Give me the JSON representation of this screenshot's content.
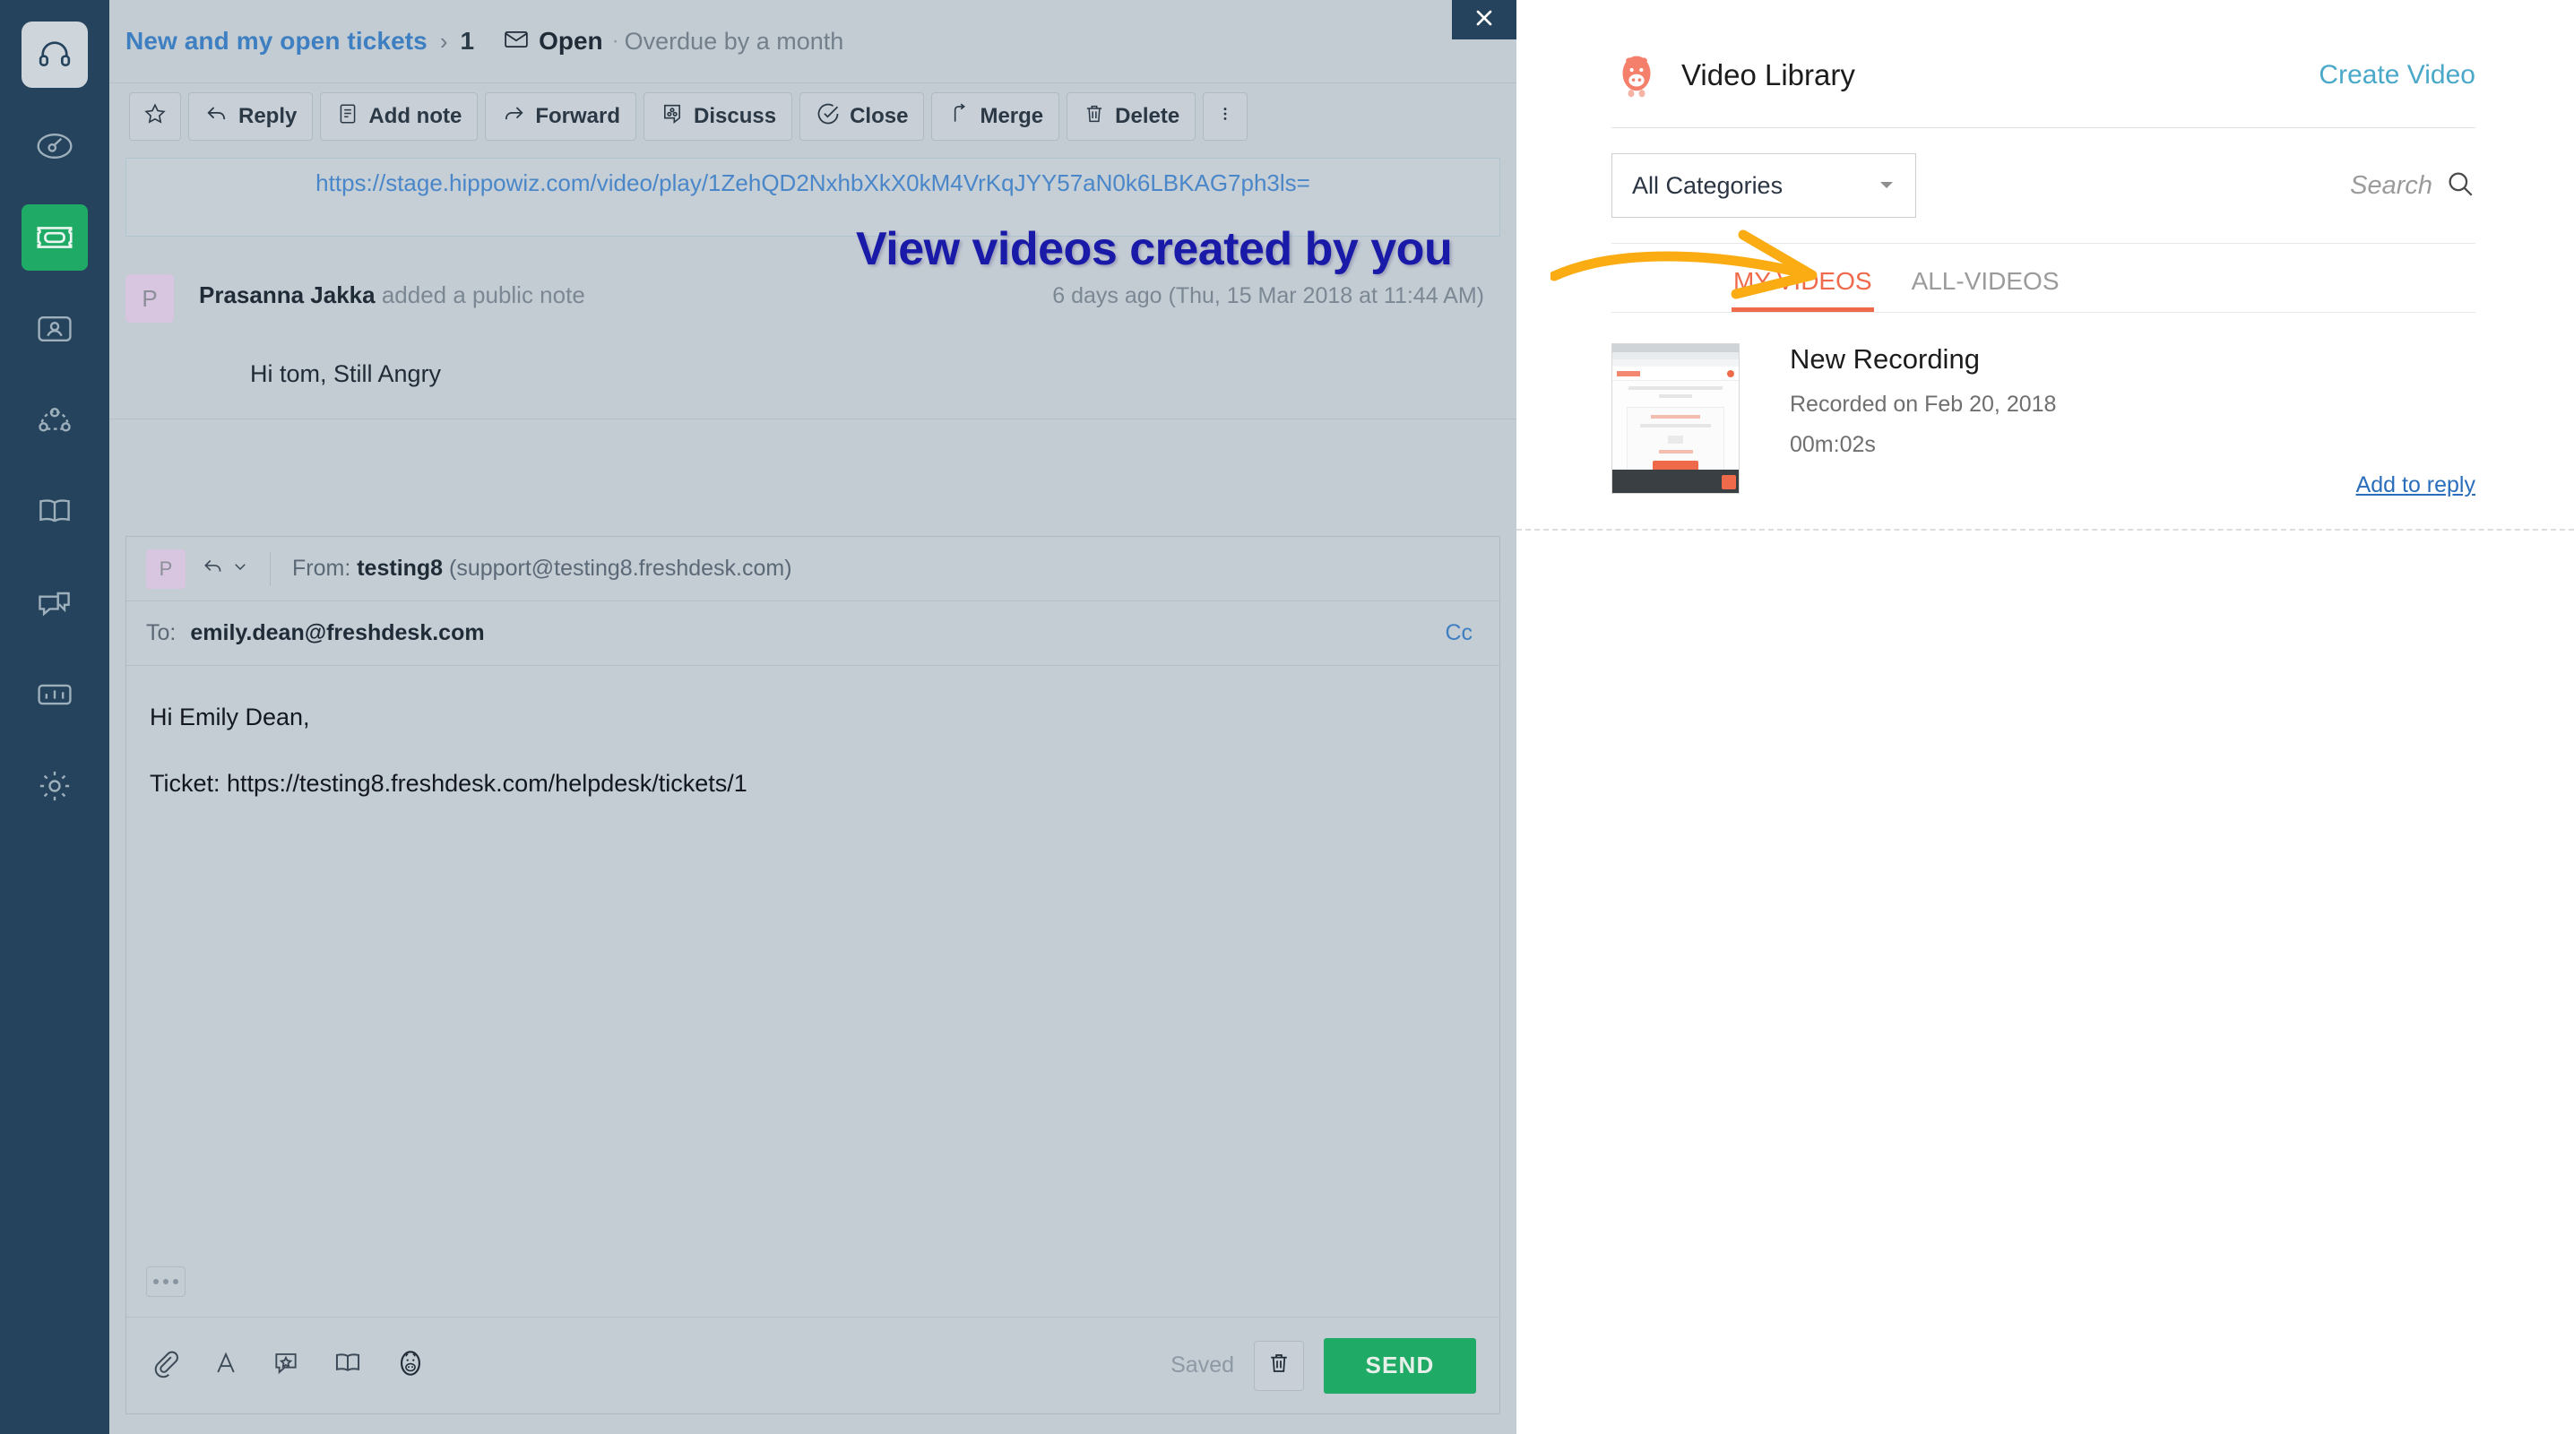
{
  "rail": {
    "items": [
      {
        "name": "brand-logo",
        "icon": "headset-icon"
      },
      {
        "name": "dashboard",
        "icon": "speedometer-icon"
      },
      {
        "name": "tickets",
        "icon": "ticket-icon",
        "active": true
      },
      {
        "name": "contacts",
        "icon": "contact-card-icon"
      },
      {
        "name": "social",
        "icon": "network-icon"
      },
      {
        "name": "solutions",
        "icon": "book-icon"
      },
      {
        "name": "forums",
        "icon": "chat-icon"
      },
      {
        "name": "reports",
        "icon": "bar-chart-icon"
      },
      {
        "name": "admin",
        "icon": "gear-icon"
      }
    ]
  },
  "breadcrumb": {
    "view_name": "New and my open tickets",
    "separator": "›",
    "ticket_number": "1",
    "status": "Open",
    "status_icon": "envelope-icon",
    "dot": "·",
    "due": "Overdue by a month"
  },
  "toolbar": {
    "buttons": [
      {
        "label": "",
        "icon": "star-icon",
        "name": "favorite-button"
      },
      {
        "label": "Reply",
        "icon": "reply-arrow-icon",
        "name": "reply-button"
      },
      {
        "label": "Add note",
        "icon": "note-icon",
        "name": "add-note-button"
      },
      {
        "label": "Forward",
        "icon": "forward-arrow-icon",
        "name": "forward-button"
      },
      {
        "label": "Discuss",
        "icon": "discuss-icon",
        "name": "discuss-button"
      },
      {
        "label": "Close",
        "icon": "check-circle-icon",
        "name": "close-button"
      },
      {
        "label": "Merge",
        "icon": "merge-icon",
        "name": "merge-button"
      },
      {
        "label": "Delete",
        "icon": "trash-icon",
        "name": "delete-button"
      },
      {
        "label": "",
        "icon": "kebab-menu-icon",
        "name": "more-actions-button"
      }
    ]
  },
  "conversation": {
    "video_url": "https://stage.hippowiz.com/video/play/1ZehQD2NxhbXkX0kM4VrKqJYY57aN0k6LBKAG7ph3ls=",
    "activity": {
      "avatar_initial": "P",
      "author": "Prasanna Jakka",
      "action": " added a public note",
      "timestamp": "6 days ago (Thu, 15 Mar 2018 at 11:44 AM)",
      "body": "Hi tom, Still Angry"
    }
  },
  "composer": {
    "avatar_initial": "P",
    "from_label": "From:",
    "from_name": "testing8",
    "from_email": "(support@testing8.freshdesk.com)",
    "to_label": "To:",
    "to_value": "emily.dean@freshdesk.com",
    "cc_label": "Cc",
    "body_line1": "Hi Emily Dean,",
    "body_line2": "Ticket: https://testing8.freshdesk.com/helpdesk/tickets/1",
    "footer_icons": [
      {
        "name": "attach-icon"
      },
      {
        "name": "text-format-icon"
      },
      {
        "name": "canned-response-icon"
      },
      {
        "name": "solutions-book-icon"
      },
      {
        "name": "hippo-video-icon"
      }
    ],
    "saved_label": "Saved",
    "discard_icon": "trash-icon",
    "send_label": "SEND"
  },
  "drawer": {
    "close_icon": "close-icon",
    "logo_icon": "hippo-logo-icon",
    "title": "Video Library",
    "create_label": "Create Video",
    "category_select": {
      "value": "All Categories",
      "caret_icon": "chevron-down-icon"
    },
    "search": {
      "placeholder": "Search",
      "icon": "search-icon"
    },
    "tabs": [
      {
        "label": "MY-VIDEOS",
        "active": true
      },
      {
        "label": "ALL-VIDEOS",
        "active": false
      }
    ],
    "videos": [
      {
        "title": "New Recording",
        "recorded": "Recorded on Feb 20, 2018",
        "duration": "00m:02s",
        "add_label": "Add to reply",
        "thumbnail": "browser-screenshot-thumbnail"
      }
    ]
  },
  "annotation": {
    "text": "View videos created by you",
    "arrow": "curved-arrow-right",
    "text_color": "#1a1aa8",
    "arrow_color": "#fbac13"
  },
  "colors": {
    "rail_bg": "#25435c",
    "accent_green": "#1faa66",
    "accent_coral": "#ef6a4b",
    "link_blue": "#3e7fc1",
    "teal_link": "#4aa8c9",
    "annotation_blue": "#1a1aa8",
    "annotation_orange": "#fbac13"
  }
}
